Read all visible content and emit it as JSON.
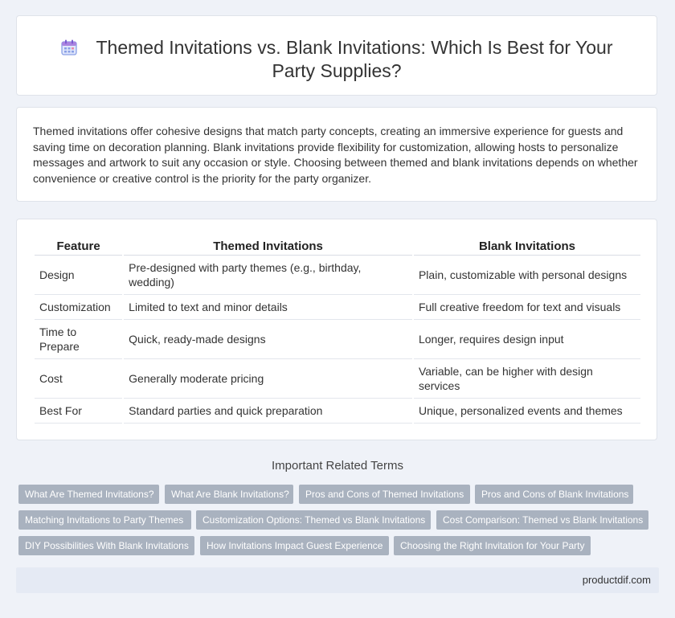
{
  "header": {
    "title": "Themed Invitations vs. Blank Invitations: Which Is Best for Your Party Supplies?",
    "icon": "calendar-icon"
  },
  "intro": "Themed invitations offer cohesive designs that match party concepts, creating an immersive experience for guests and saving time on decoration planning. Blank invitations provide flexibility for customization, allowing hosts to personalize messages and artwork to suit any occasion or style. Choosing between themed and blank invitations depends on whether convenience or creative control is the priority for the party organizer.",
  "table": {
    "headers": [
      "Feature",
      "Themed Invitations",
      "Blank Invitations"
    ],
    "rows": [
      [
        "Design",
        "Pre-designed with party themes (e.g., birthday, wedding)",
        "Plain, customizable with personal designs"
      ],
      [
        "Customization",
        "Limited to text and minor details",
        "Full creative freedom for text and visuals"
      ],
      [
        "Time to Prepare",
        "Quick, ready-made designs",
        "Longer, requires design input"
      ],
      [
        "Cost",
        "Generally moderate pricing",
        "Variable, can be higher with design services"
      ],
      [
        "Best For",
        "Standard parties and quick preparation",
        "Unique, personalized events and themes"
      ]
    ]
  },
  "related": {
    "title": "Important Related Terms",
    "tags": [
      "What Are Themed Invitations?",
      "What Are Blank Invitations?",
      "Pros and Cons of Themed Invitations",
      "Pros and Cons of Blank Invitations",
      "Matching Invitations to Party Themes",
      "Customization Options: Themed vs Blank Invitations",
      "Cost Comparison: Themed vs Blank Invitations",
      "DIY Possibilities With Blank Invitations",
      "How Invitations Impact Guest Experience",
      "Choosing the Right Invitation for Your Party"
    ]
  },
  "footer": {
    "site": "productdif.com"
  },
  "colors": {
    "tag_bg": "#a9b2bf",
    "page_bg": "#eff2f8",
    "footer_bg": "#e5eaf4"
  }
}
